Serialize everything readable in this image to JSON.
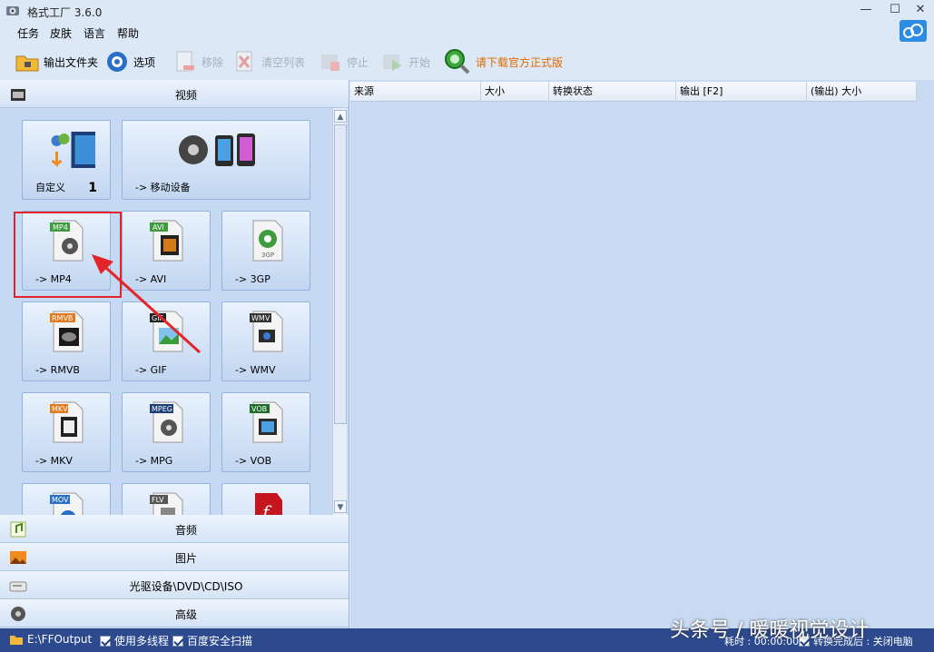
{
  "window": {
    "title": "格式工厂 3.6.0",
    "min": "—",
    "max": "☐",
    "close": "✕"
  },
  "menu": [
    "任务",
    "皮肤",
    "语言",
    "帮助"
  ],
  "toolbar": {
    "output_folder": "输出文件夹",
    "options": "选项",
    "remove": "移除",
    "clear_list": "清空列表",
    "stop": "停止",
    "start": "开始",
    "download": "请下载官方正式版"
  },
  "categories": {
    "video": "视频",
    "audio": "音频",
    "image": "图片",
    "disc": "光驱设备\\DVD\\CD\\ISO",
    "advanced": "高级"
  },
  "tiles": {
    "custom": "自定义",
    "custom_count": "1",
    "mobile": "-> 移动设备",
    "mp4": "-> MP4",
    "avi": "-> AVI",
    "3gp": "-> 3GP",
    "rmvb": "-> RMVB",
    "gif": "-> GIF",
    "wmv": "-> WMV",
    "mkv": "-> MKV",
    "mpg": "-> MPG",
    "vob": "-> VOB"
  },
  "tile_badges": {
    "mp4": "MP4",
    "avi": "AVI",
    "3gp": "3GP",
    "rmvb": "RMVB",
    "gif": "GIF",
    "wmv": "WMV",
    "mkv": "MKV",
    "mpg": "MPEG",
    "vob": "VOB",
    "mov": "MOV",
    "flv": "FLV"
  },
  "table": {
    "columns": [
      "来源",
      "大小",
      "转换状态",
      "输出 [F2]",
      "(输出) 大小"
    ]
  },
  "status": {
    "output_path": "E:\\FFOutput",
    "multithread": "使用多线程",
    "safe_scan": "百度安全扫描",
    "elapsed": "耗时 : 00:00:00",
    "after_convert": "转换完成后 : 关闭电脑"
  },
  "watermark": "头条号 / 暖暖视觉设计",
  "colors": {
    "highlight": "#e2252a",
    "statusbar": "#2d4a8f",
    "download_text": "#e06a00"
  }
}
